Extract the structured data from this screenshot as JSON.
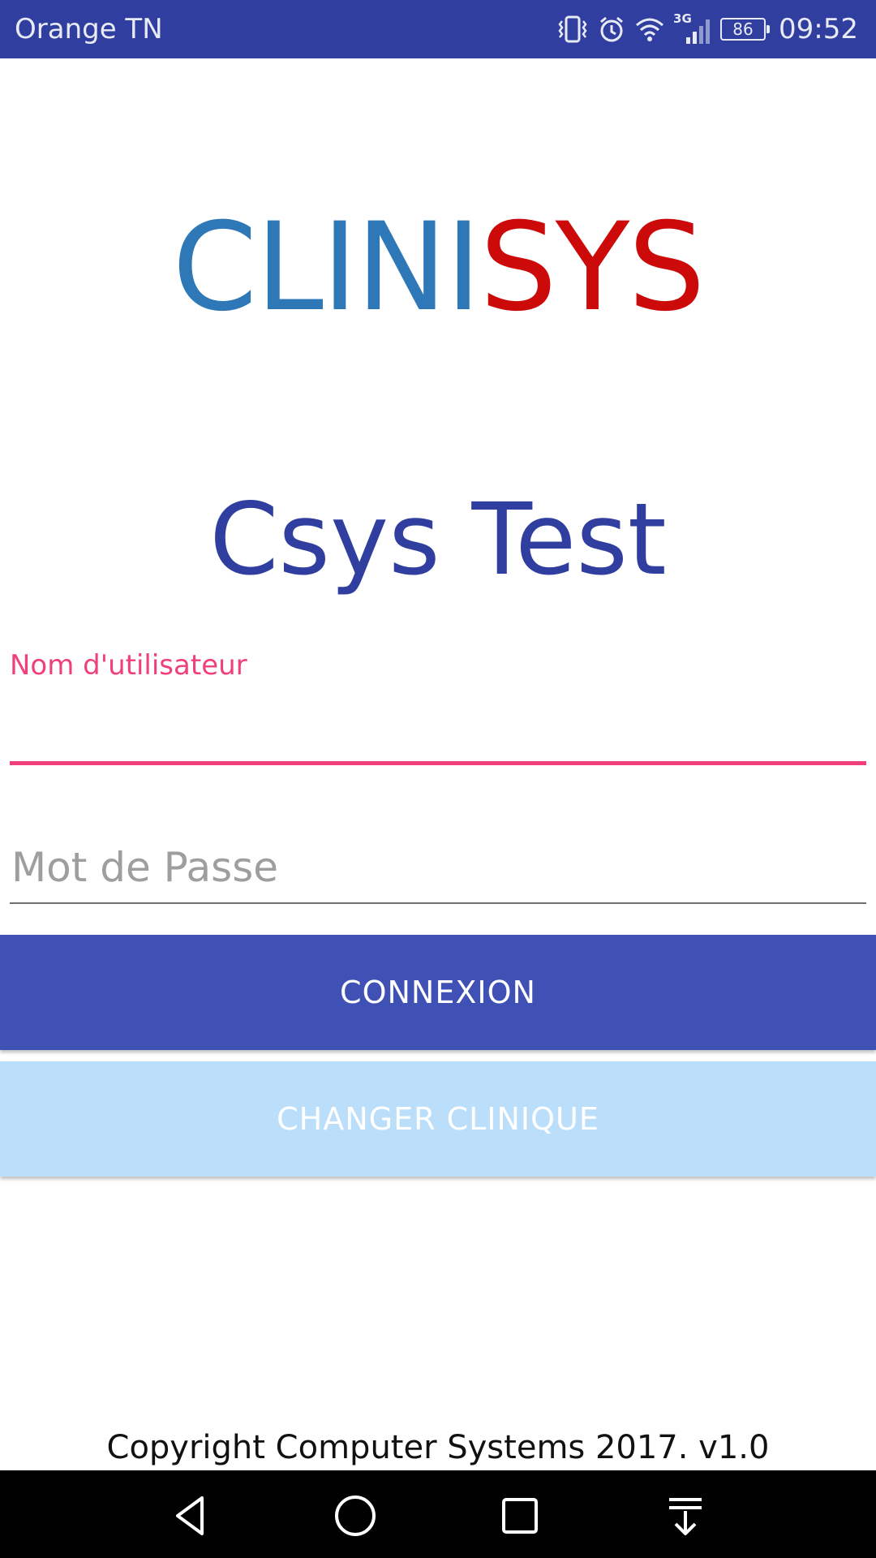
{
  "status_bar": {
    "carrier": "Orange TN",
    "network_label": "3G",
    "battery_level": "86",
    "time": "09:52",
    "icons": [
      "vibrate-icon",
      "alarm-icon",
      "wifi-icon",
      "signal-3g-icon",
      "battery-icon"
    ]
  },
  "logo": {
    "part1": "CLINI",
    "part2": "SYS",
    "colors": {
      "part1": "#2f78b8",
      "part2": "#cc0a0a"
    }
  },
  "clinic": {
    "name": "Csys Test"
  },
  "form": {
    "username": {
      "label": "Nom d'utilisateur",
      "value": ""
    },
    "password": {
      "placeholder": "Mot de Passe",
      "value": ""
    }
  },
  "buttons": {
    "connect_label": "CONNEXION",
    "change_clinic_label": "CHANGER CLINIQUE"
  },
  "footer": {
    "copyright": "Copyright Computer Systems 2017. v1.0"
  },
  "nav_bar": {
    "icons": [
      "back-icon",
      "home-icon",
      "recents-icon",
      "notifications-pull-icon"
    ]
  },
  "colors": {
    "primary": "#3f51b5",
    "primary_dark": "#303f9f",
    "accent": "#f0407a",
    "secondary_button": "#bbdefb"
  }
}
